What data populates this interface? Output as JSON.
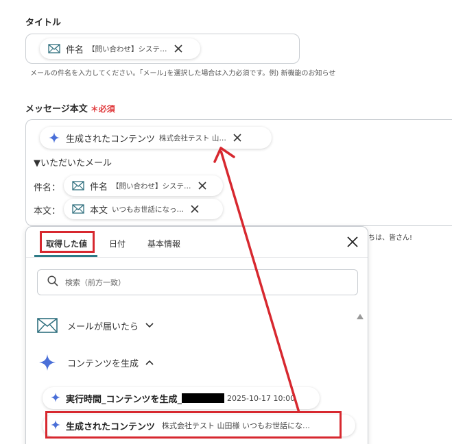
{
  "title_field": {
    "label": "タイトル",
    "chip": {
      "name": "件名",
      "value": "【問い合わせ】システ…"
    },
    "hint": "メールの件名を入力してください。｢メール｣を選択した場合は入力必須です。例) 新機能のお知らせ"
  },
  "message_field": {
    "label": "メッセージ本文",
    "required_mark": "＊必須",
    "chip_main": {
      "name": "生成されたコンテンツ",
      "value": "株式会社テスト 山…"
    },
    "line_received": "▼いただいたメール",
    "subject_label": "件名：",
    "subject_chip": {
      "name": "件名",
      "value": "【問い合わせ】システ…"
    },
    "body_label": "本文：",
    "body_chip": {
      "name": "本文",
      "value": "いつもお世話になっ…"
    },
    "side_text": "ちは、皆さん!"
  },
  "popup": {
    "tabs": [
      "取得した値",
      "日付",
      "基本情報"
    ],
    "search_placeholder": "検索（前方一致）",
    "groups": [
      {
        "label": "メールが届いたら",
        "icon": "mail-icon",
        "state": "collapsed"
      },
      {
        "label": "コンテンツを生成",
        "icon": "sparkle-icon",
        "state": "expanded"
      }
    ],
    "results": [
      {
        "name": "実行時間_コンテンツを生成_",
        "value": "2025-10-17 10:00"
      },
      {
        "name": "生成されたコンテンツ",
        "value": "株式会社テスト 山田様 いつもお世話にな…"
      }
    ]
  },
  "colors": {
    "highlight_red": "#d7282f",
    "tab_accent": "#2d7a86",
    "required_red": "#e0383b",
    "sparkle_blue": "#4a6fd8",
    "mail_teal": "#2f6f7e"
  }
}
